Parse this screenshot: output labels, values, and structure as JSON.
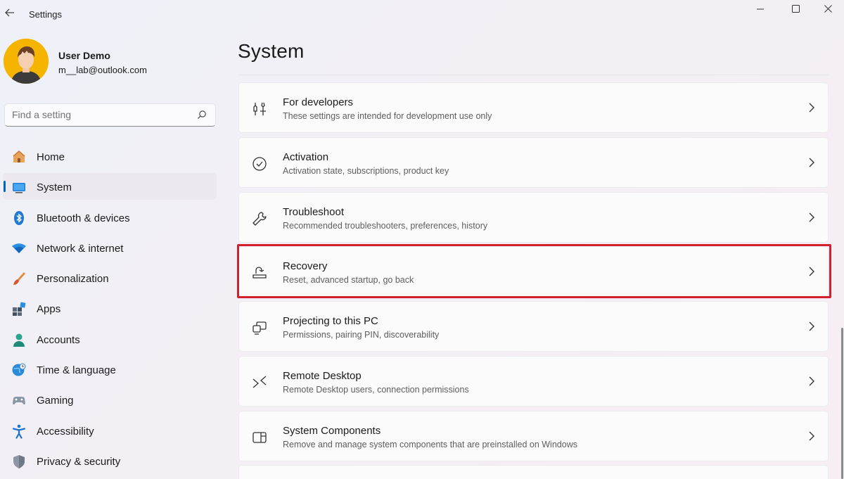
{
  "window": {
    "title": "Settings",
    "controls": {
      "minimize": "minimize-icon",
      "maximize": "maximize-icon",
      "close": "close-icon"
    }
  },
  "user": {
    "name": "User Demo",
    "email": "m__lab@outlook.com"
  },
  "search": {
    "placeholder": "Find a setting"
  },
  "nav": {
    "selected": "System",
    "items": [
      {
        "label": "Home",
        "icon": "home-icon"
      },
      {
        "label": "System",
        "icon": "system-icon"
      },
      {
        "label": "Bluetooth & devices",
        "icon": "bluetooth-icon"
      },
      {
        "label": "Network & internet",
        "icon": "wifi-icon"
      },
      {
        "label": "Personalization",
        "icon": "brush-icon"
      },
      {
        "label": "Apps",
        "icon": "apps-icon"
      },
      {
        "label": "Accounts",
        "icon": "accounts-icon"
      },
      {
        "label": "Time & language",
        "icon": "globe-clock-icon"
      },
      {
        "label": "Gaming",
        "icon": "gamepad-icon"
      },
      {
        "label": "Accessibility",
        "icon": "accessibility-icon"
      },
      {
        "label": "Privacy & security",
        "icon": "shield-icon"
      }
    ]
  },
  "main": {
    "title": "System",
    "cards": [
      {
        "title": "For developers",
        "subtitle": "These settings are intended for development use only",
        "icon": "developer-tools-icon"
      },
      {
        "title": "Activation",
        "subtitle": "Activation state, subscriptions, product key",
        "icon": "activation-check-icon"
      },
      {
        "title": "Troubleshoot",
        "subtitle": "Recommended troubleshooters, preferences, history",
        "icon": "wrench-icon"
      },
      {
        "title": "Recovery",
        "subtitle": "Reset, advanced startup, go back",
        "icon": "recovery-icon",
        "highlighted": true
      },
      {
        "title": "Projecting to this PC",
        "subtitle": "Permissions, pairing PIN, discoverability",
        "icon": "projecting-icon"
      },
      {
        "title": "Remote Desktop",
        "subtitle": "Remote Desktop users, connection permissions",
        "icon": "remote-desktop-icon"
      },
      {
        "title": "System Components",
        "subtitle": "Remove and manage system components that are preinstalled on Windows",
        "icon": "system-components-icon"
      }
    ]
  },
  "colors": {
    "accent": "#0067c0",
    "highlight": "#d4202d",
    "avatar_bg": "#f4b400"
  }
}
